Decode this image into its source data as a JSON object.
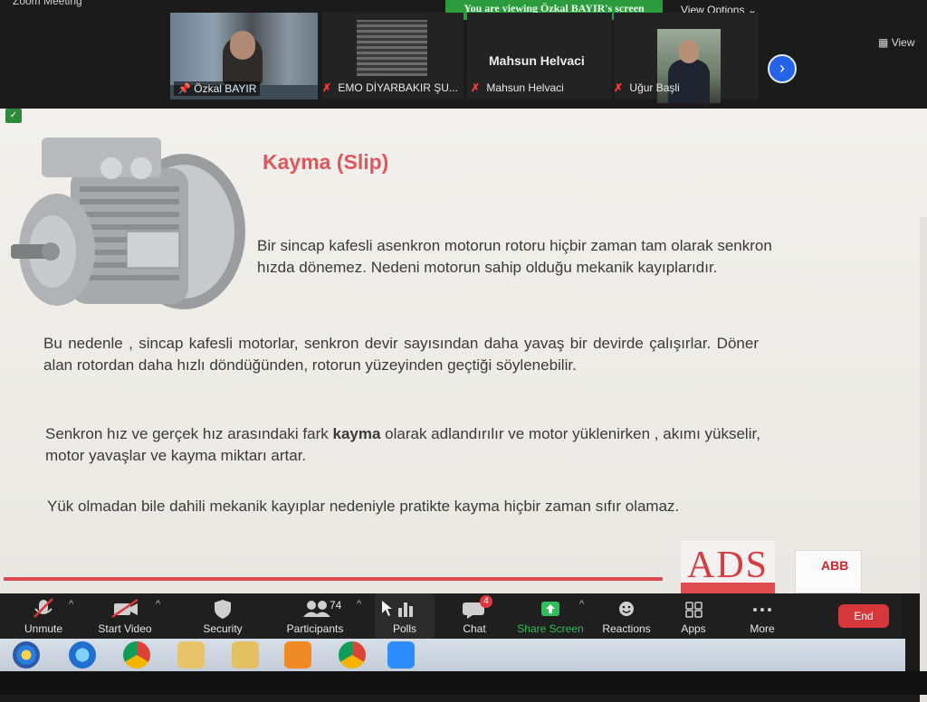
{
  "window": {
    "title": "Zoom Meeting"
  },
  "banner": {
    "viewing": "You are viewing Özkal BAYIR's screen"
  },
  "top_controls": {
    "view_options": "View Options ⌄",
    "view": "View"
  },
  "participants_strip": [
    {
      "name": "Özkal BAYIR",
      "muted": false
    },
    {
      "name": "EMO DİYARBAKIR ŞU...",
      "muted": true
    },
    {
      "name": "Mahsun Helvaci",
      "muted": true,
      "big_label": "Mahsun Helvaci"
    },
    {
      "name": "Uğur Başli",
      "muted": true
    }
  ],
  "slide": {
    "title": "Kayma  (Slip)",
    "para1": "Bir sincap kafesli asenkron motorun rotoru hiçbir zaman tam olarak senkron hızda dönemez. Nedeni motorun sahip olduğu mekanik kayıplarıdır.",
    "para2": "Bu nedenle , sincap kafesli motorlar, senkron devir sayısından daha yavaş bir devirde çalışırlar. Döner alan  rotordan daha hızlı döndüğünden, rotorun yüzeyinden geçtiği söylenebilir.",
    "para3_pre": "Senkron hız ve gerçek hız arasındaki fark ",
    "para3_bold": "kayma",
    "para3_post": " olarak adlandırılır ve motor yüklenirken , akımı yükselir, motor yavaşlar ve kayma miktarı artar.",
    "para4": "Yük olmadan bile dahili mekanik kayıplar nedeniyle pratikte  kayma hiçbir zaman sıfır olamaz.",
    "logo_ads": "ADS",
    "logo_abb": "ABB",
    "accent_color": "#e0575b"
  },
  "toolbar": {
    "unmute": "Unmute",
    "start_video": "Start Video",
    "security": "Security",
    "participants": "Participants",
    "participant_count": "74",
    "polls": "Polls",
    "chat": "Chat",
    "chat_badge": "4",
    "share_screen": "Share Screen",
    "reactions": "Reactions",
    "apps": "Apps",
    "more": "More",
    "end": "End"
  },
  "taskbar": {
    "icons": [
      "windows-start-icon",
      "internet-explorer-icon",
      "chrome-icon",
      "mail-icon",
      "folder-icon",
      "media-player-icon",
      "chrome-app-icon",
      "zoom-icon"
    ]
  }
}
